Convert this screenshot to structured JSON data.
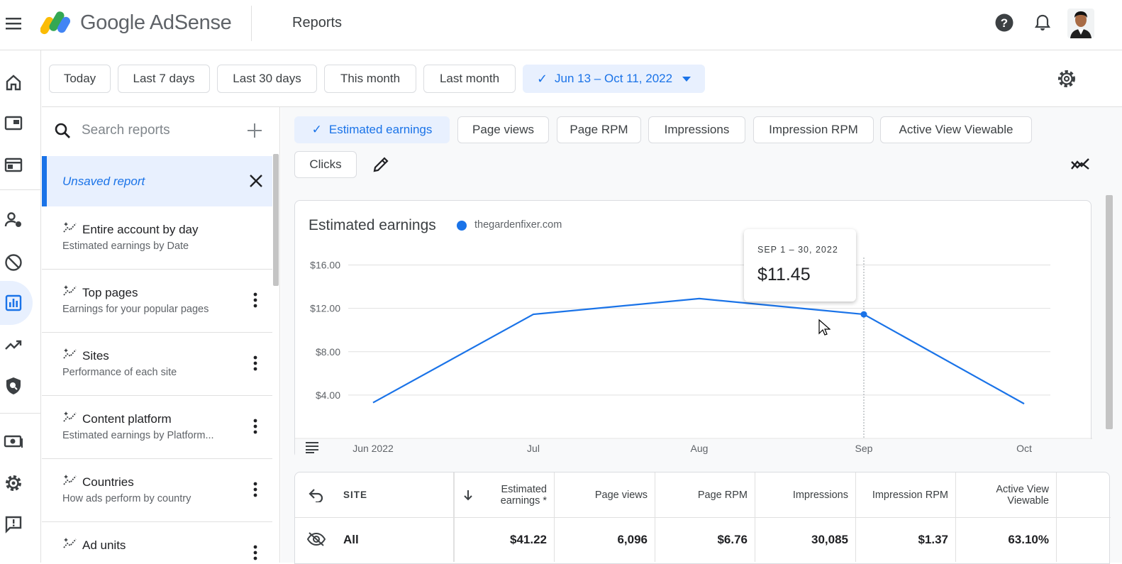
{
  "app": {
    "brand": "Google AdSense",
    "page_title": "Reports"
  },
  "date_filters": {
    "chips": [
      "Today",
      "Last 7 days",
      "Last 30 days",
      "This month",
      "Last month"
    ],
    "selected_range": "Jun 13 – Oct 11, 2022"
  },
  "sidebar": {
    "search_placeholder": "Search reports",
    "unsaved_label": "Unsaved report",
    "reports": [
      {
        "title": "Entire account by day",
        "subtitle": "Estimated earnings by Date"
      },
      {
        "title": "Top pages",
        "subtitle": "Earnings for your popular pages"
      },
      {
        "title": "Sites",
        "subtitle": "Performance of each site"
      },
      {
        "title": "Content platform",
        "subtitle": "Estimated earnings by Platform..."
      },
      {
        "title": "Countries",
        "subtitle": "How ads perform by country"
      },
      {
        "title": "Ad units",
        "subtitle": ""
      }
    ]
  },
  "metrics": {
    "chips": [
      "Estimated earnings",
      "Page views",
      "Page RPM",
      "Impressions",
      "Impression RPM",
      "Active View Viewable",
      "Clicks"
    ],
    "selected": "Estimated earnings"
  },
  "chart": {
    "title": "Estimated earnings",
    "legend": "thegardenfixer.com",
    "tooltip_range": "SEP 1 – 30, 2022",
    "tooltip_value": "$11.45"
  },
  "chart_data": {
    "type": "line",
    "title": "Estimated earnings",
    "x": [
      "Jun 2022",
      "Jul",
      "Aug",
      "Sep",
      "Oct"
    ],
    "x_ticks": [
      "Jun 2022",
      "Jul",
      "Aug",
      "Sep",
      "Oct"
    ],
    "y_ticks": [
      "$4.00",
      "$8.00",
      "$12.00",
      "$16.00"
    ],
    "ylim": [
      0,
      18
    ],
    "series": [
      {
        "name": "thegardenfixer.com",
        "color": "#1a73e8",
        "values": [
          3.3,
          11.45,
          12.9,
          11.45,
          3.2
        ]
      }
    ],
    "highlighted_index": 3,
    "grid": true,
    "legend_position": "top-left"
  },
  "table": {
    "headers": {
      "site": "SITE",
      "estimated_earnings": "Estimated earnings *",
      "page_views": "Page views",
      "page_rpm": "Page RPM",
      "impressions": "Impressions",
      "impression_rpm": "Impression RPM",
      "active_view": "Active View Viewable"
    },
    "rows": [
      {
        "site": "All",
        "estimated_earnings": "$41.22",
        "page_views": "6,096",
        "page_rpm": "$6.76",
        "impressions": "30,085",
        "impression_rpm": "$1.37",
        "active_view": "63.10%"
      }
    ]
  },
  "colors": {
    "accent": "#1a73e8",
    "selected_bg": "#e8f0fe"
  }
}
